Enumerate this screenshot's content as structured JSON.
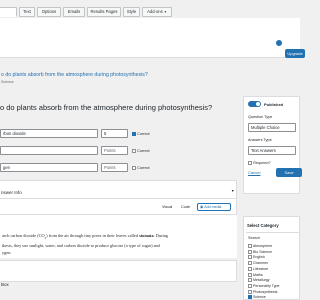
{
  "tabs": [
    {
      "label": ""
    },
    {
      "label": "Text"
    },
    {
      "label": "Options"
    },
    {
      "label": "Emails"
    },
    {
      "label": "Results Pages"
    },
    {
      "label": "Style"
    },
    {
      "label": "Add-ons"
    }
  ],
  "header": {
    "breadcrumb": "o do plants absorb from the atmosphere during photosynthesis?",
    "sub": "Science",
    "right_button": "Upgrade"
  },
  "editor": {
    "question": "o do plants absorb from the atmosphere during photosynthesis?",
    "answers": [
      {
        "text": "rbon dioxide",
        "points": "5",
        "correct_label": "Correct",
        "checked": true
      },
      {
        "text": "",
        "points": "Points",
        "correct_label": "Correct",
        "checked": false
      },
      {
        "text": "gen",
        "points": "Points",
        "correct_label": "Correct",
        "checked": false
      }
    ],
    "answer_info_label": "nswer Info",
    "visual_tab": "Visual",
    "code_tab": "Code",
    "add_media": "Add media",
    "body_text_1": "arch carbon dioxide (CO",
    "body_text_1b": "2",
    "body_text_1c": ") from the air through tiny pores in their leaves called ",
    "body_bold": "stomata",
    "body_text_2": ". During",
    "body_text_3": "thesis, they use sunlight, water, and carbon dioxide to produce glucose (a type of sugar) and",
    "body_text_4": "ygen.",
    "bottom_label": "Box"
  },
  "publish": {
    "toggle_label": "Published",
    "question_type_label": "Question Type",
    "question_type_value": "Multiple Choice",
    "answers_type_label": "Answers Type",
    "answers_type_value": "Text Answers",
    "required_label": "Required?",
    "cancel": "Cancel",
    "save": "Save Question"
  },
  "category": {
    "title": "Select Category",
    "search_label": "Search",
    "items": [
      {
        "label": "Atmosphere",
        "checked": false
      },
      {
        "label": "Bio Science",
        "checked": false
      },
      {
        "label": "English",
        "checked": false
      },
      {
        "label": "Grammer",
        "checked": false
      },
      {
        "label": "Literature",
        "checked": false
      },
      {
        "label": "Maths",
        "checked": false
      },
      {
        "label": "Metallurgy",
        "checked": false
      },
      {
        "label": "Personality Type",
        "checked": false
      },
      {
        "label": "Photosynthesis",
        "checked": false
      },
      {
        "label": "Science",
        "checked": true
      }
    ]
  },
  "colors": {
    "accent": "#2271b1",
    "link": "#2271b1"
  }
}
